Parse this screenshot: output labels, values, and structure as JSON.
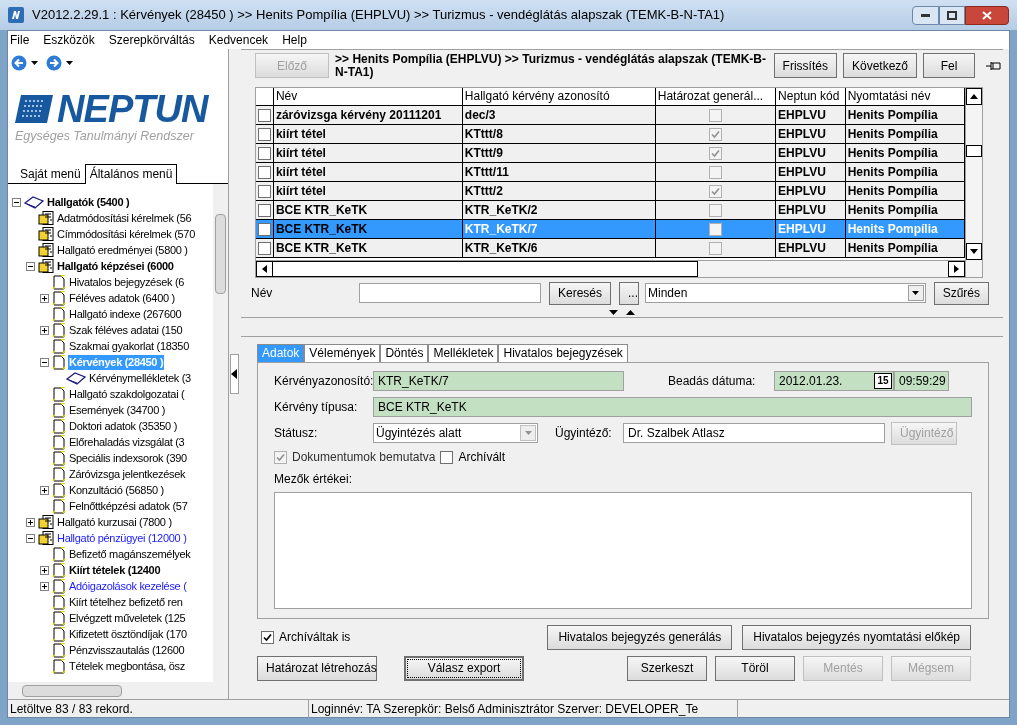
{
  "window": {
    "title": "V2012.2.29.1 : Kérvények (28450  )  >> Henits Pompília (EHPLVU) >> Turizmus - vendéglátás alapszak (TEMK-B-N-TA1)"
  },
  "menu": [
    "File",
    "Eszközök",
    "Szerepkörváltás",
    "Kedvencek",
    "Help"
  ],
  "logo": {
    "name": "NEPTUN",
    "tagline": "Egységes Tanulmányi Rendszer"
  },
  "menu_tabs": [
    {
      "label": "Saját menü",
      "selected": false
    },
    {
      "label": "Általános menü",
      "selected": true
    }
  ],
  "tree": [
    {
      "label": "Hallgatók (5400  )",
      "kind": "book",
      "bold": true,
      "selected": false,
      "expanded": true,
      "children": [
        {
          "label": "Adatmódosítási kérelmek (56",
          "kind": "docs",
          "bold": false,
          "selected": false
        },
        {
          "label": "Címmódosítási kérelmek (570",
          "kind": "docs",
          "bold": false,
          "selected": false
        },
        {
          "label": "Hallgató eredményei (5800  )",
          "kind": "docs",
          "bold": false,
          "selected": false
        },
        {
          "label": "Hallgató képzései (6000",
          "kind": "docs",
          "bold": true,
          "selected": false,
          "expanded": true,
          "children": [
            {
              "label": "Hivatalos bejegyzések (6",
              "kind": "page",
              "bold": false,
              "selected": false
            },
            {
              "label": "Féléves adatok (6400  )",
              "kind": "page",
              "bold": false,
              "selected": false,
              "expanded": false
            },
            {
              "label": "Hallgató indexe (267600",
              "kind": "page",
              "bold": false,
              "selected": false
            },
            {
              "label": "Szak féléves adatai (150",
              "kind": "page",
              "bold": false,
              "selected": false,
              "expanded": false
            },
            {
              "label": "Szakmai gyakorlat (18350",
              "kind": "page",
              "bold": false,
              "selected": false
            },
            {
              "label": "Kérvények (28450  )",
              "kind": "page",
              "bold": true,
              "selected": true,
              "expanded": true,
              "children": [
                {
                  "label": "Kérvénymellékletek (3",
                  "kind": "book",
                  "bold": false,
                  "selected": false
                }
              ]
            },
            {
              "label": "Hallgató szakdolgozatai (",
              "kind": "page",
              "bold": false,
              "selected": false
            },
            {
              "label": "Események (34700  )",
              "kind": "page",
              "bold": false,
              "selected": false
            },
            {
              "label": "Doktori adatok (35350  )",
              "kind": "page",
              "bold": false,
              "selected": false
            },
            {
              "label": "Előrehaladás vizsgálat (3",
              "kind": "page",
              "bold": false,
              "selected": false
            },
            {
              "label": "Speciális indexsorok (390",
              "kind": "page",
              "bold": false,
              "selected": false
            },
            {
              "label": "Záróvizsga jelentkezések",
              "kind": "page",
              "bold": false,
              "selected": false
            },
            {
              "label": "Konzultáció (56850  )",
              "kind": "page",
              "bold": false,
              "selected": false,
              "expanded": false
            },
            {
              "label": "Felnőttképzési adatok (57",
              "kind": "page",
              "bold": false,
              "selected": false
            }
          ]
        },
        {
          "label": "Hallgató kurzusai (7800  )",
          "kind": "docs",
          "bold": false,
          "selected": false,
          "expanded": false
        },
        {
          "label": "Hallgató pénzügyei (12000  )",
          "kind": "docs",
          "bold": false,
          "color": "#1a1aff",
          "selected": false,
          "expanded": true,
          "children": [
            {
              "label": "Befizető magánszemélyek",
              "kind": "page",
              "bold": false,
              "selected": false
            },
            {
              "label": "Kiírt tételek (12400",
              "kind": "page",
              "bold": true,
              "selected": false,
              "expanded": false
            },
            {
              "label": "Adóigazolások kezelése (",
              "kind": "page",
              "bold": false,
              "color": "#1a1aff",
              "selected": false,
              "expanded": false
            },
            {
              "label": "Kiírt tételhez befizető ren",
              "kind": "page",
              "bold": false,
              "selected": false
            },
            {
              "label": "Elvégzett műveletek (125",
              "kind": "page",
              "bold": false,
              "selected": false
            },
            {
              "label": "Kifizetett ösztöndíjak (170",
              "kind": "page",
              "bold": false,
              "selected": false
            },
            {
              "label": "Pénzvisszautalás (12600",
              "kind": "page",
              "bold": false,
              "selected": false
            },
            {
              "label": "Tételek megbontása, ösz",
              "kind": "page",
              "bold": false,
              "selected": false
            }
          ]
        }
      ]
    }
  ],
  "toolbar": {
    "prev": {
      "label": "Előző",
      "disabled": true
    },
    "path": ">> Henits Pompília (EHPLVU) >> Turizmus - vendéglátás alapszak (TEMK-B-N-TA1)",
    "buttons": [
      "Frissítés",
      "Következő",
      "Fel"
    ]
  },
  "table": {
    "columns": [
      "Név",
      "Hallgató kérvény azonosító",
      "Határozat generál...",
      "Neptun kód",
      "Nyomtatási név"
    ],
    "rows": [
      {
        "checked": false,
        "name": "záróvizsga kérvény 20111201",
        "id": "dec/3",
        "decision": false,
        "code": "EHPLVU",
        "print_name": "Henits Pompília",
        "selected": false
      },
      {
        "checked": false,
        "name": "kiírt tétel",
        "id": "KTttt/8",
        "decision": true,
        "code": "EHPLVU",
        "print_name": "Henits Pompília",
        "selected": false
      },
      {
        "checked": false,
        "name": "kiírt tétel",
        "id": "KTttt/9",
        "decision": true,
        "code": "EHPLVU",
        "print_name": "Henits Pompília",
        "selected": false
      },
      {
        "checked": false,
        "name": "kiírt tétel",
        "id": "KTttt/11",
        "decision": false,
        "code": "EHPLVU",
        "print_name": "Henits Pompília",
        "selected": false
      },
      {
        "checked": false,
        "name": "kiírt tétel",
        "id": "KTttt/2",
        "decision": true,
        "code": "EHPLVU",
        "print_name": "Henits Pompília",
        "selected": false
      },
      {
        "checked": false,
        "name": "BCE KTR_KeTK",
        "id": "KTR_KeTK/2",
        "decision": false,
        "code": "EHPLVU",
        "print_name": "Henits Pompília",
        "selected": false
      },
      {
        "checked": false,
        "name": "BCE KTR_KeTK",
        "id": "KTR_KeTK/7",
        "decision": false,
        "code": "EHPLVU",
        "print_name": "Henits Pompília",
        "selected": true
      },
      {
        "checked": false,
        "name": "BCE KTR_KeTK",
        "id": "KTR_KeTK/6",
        "decision": false,
        "code": "EHPLVU",
        "print_name": "Henits Pompília",
        "selected": false
      }
    ]
  },
  "filter": {
    "label": "Név",
    "search_button": "Keresés",
    "more_button": "...",
    "scope": "Minden",
    "filter_button": "Szűrés"
  },
  "detail_tabs": [
    {
      "label": "Adatok",
      "selected": true
    },
    {
      "label": "Vélemények",
      "selected": false
    },
    {
      "label": "Döntés",
      "selected": false
    },
    {
      "label": "Mellékletek",
      "selected": false
    },
    {
      "label": "Hivatalos bejegyzések",
      "selected": false
    }
  ],
  "form": {
    "request_id": {
      "label": "Kérvényazonosító:",
      "value": "KTR_KeTK/7"
    },
    "submitted": {
      "label": "Beadás dátuma:",
      "date": "2012.01.23.",
      "calendar": "15",
      "time": "09:59:29"
    },
    "type": {
      "label": "Kérvény típusa:",
      "value": "BCE KTR_KeTK"
    },
    "status": {
      "label": "Státusz:",
      "value": "Ügyintézés alatt"
    },
    "handler": {
      "label": "Ügyintéző:",
      "value": "Dr. Szalbek Atlasz",
      "button": "Ügyintéző",
      "button_disabled": true
    },
    "documents": {
      "label": "Dokumentumok bemutatva",
      "checked": true,
      "disabled": true
    },
    "archived": {
      "label": "Archívált",
      "checked": false
    },
    "fields": {
      "label": "Mezők értékei:"
    }
  },
  "archived_too": {
    "label": "Archíváltak is",
    "checked": true
  },
  "actions_top": [
    {
      "label": "Hivatalos bejegyzés generálás",
      "disabled": false
    },
    {
      "label": "Hivatalos bejegyzés nyomtatási előkép",
      "disabled": false
    }
  ],
  "actions_left": [
    {
      "label": "Határozat létrehozás",
      "focused": false
    },
    {
      "label": "Válasz export",
      "focused": true
    }
  ],
  "actions_right": [
    {
      "label": "Szerkeszt",
      "disabled": false
    },
    {
      "label": "Töröl",
      "disabled": false
    },
    {
      "label": "Mentés",
      "disabled": true
    },
    {
      "label": "Mégsem",
      "disabled": true
    }
  ],
  "status_bar": {
    "records": "Letöltve 83 / 83 rekord.",
    "session": "Loginnév: TA   Szerepkör: Belső Adminisztrátor   Szerver: DEVELOPER_Te"
  }
}
